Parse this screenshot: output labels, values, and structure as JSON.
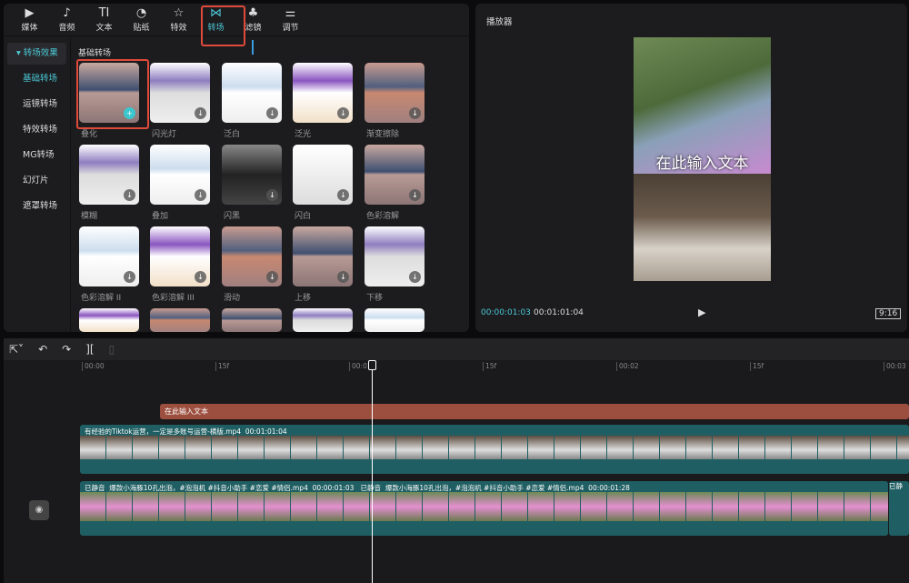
{
  "toolbar": {
    "items": [
      {
        "label": "媒体",
        "icon": "media-icon"
      },
      {
        "label": "音频",
        "icon": "audio-icon"
      },
      {
        "label": "文本",
        "icon": "text-icon"
      },
      {
        "label": "贴纸",
        "icon": "sticker-icon"
      },
      {
        "label": "特效",
        "icon": "effects-icon"
      },
      {
        "label": "转场",
        "icon": "transition-icon",
        "active": true
      },
      {
        "label": "滤镜",
        "icon": "filter-icon"
      },
      {
        "label": "调节",
        "icon": "adjust-icon"
      }
    ]
  },
  "sidebar": {
    "items": [
      "转场效果",
      "基础转场",
      "运镜转场",
      "特效转场",
      "MG转场",
      "幻灯片",
      "遮罩转场"
    ]
  },
  "section_title": "基础转场",
  "transitions": [
    [
      "叠化",
      "闪光灯",
      "泛白",
      "泛光",
      "渐变擦除"
    ],
    [
      "模糊",
      "叠加",
      "闪黑",
      "闪白",
      "色彩溶解"
    ],
    [
      "色彩溶解 II",
      "色彩溶解 III",
      "滑动",
      "上移",
      "下移"
    ]
  ],
  "player": {
    "title": "播放器",
    "overlay_text": "在此输入文本",
    "current_time": "00:00:01:03",
    "total_time": "00:01:01:04",
    "ratio": "9:16"
  },
  "timeline": {
    "ticks": [
      "00:00",
      "15f",
      "00:01",
      "15f",
      "00:02",
      "15f",
      "00:03"
    ],
    "text_clip": "在此输入文本",
    "main_clip": {
      "name": "有经验的Tiktok运营，一定是多账号运营-横版.mp4",
      "duration": "00:01:01:04"
    },
    "sub_clips": [
      {
        "muted": "已静音",
        "name": "爆款小海豚10孔出泡，#泡泡机 #抖音小助手 #恋爱 #情侣.mp4",
        "duration": "00:00:01:03"
      },
      {
        "muted": "已静音",
        "name": "爆款小海豚10孔出泡，#泡泡机 #抖音小助手 #恋爱 #情侣.mp4",
        "duration": "00:00:01:28"
      },
      {
        "muted": "已静"
      }
    ]
  },
  "colors": {
    "accent": "#4cc9d6",
    "text_clip": "#9c4f3f",
    "video_clip": "#1f5e62",
    "highlight": "#e04a3a"
  }
}
